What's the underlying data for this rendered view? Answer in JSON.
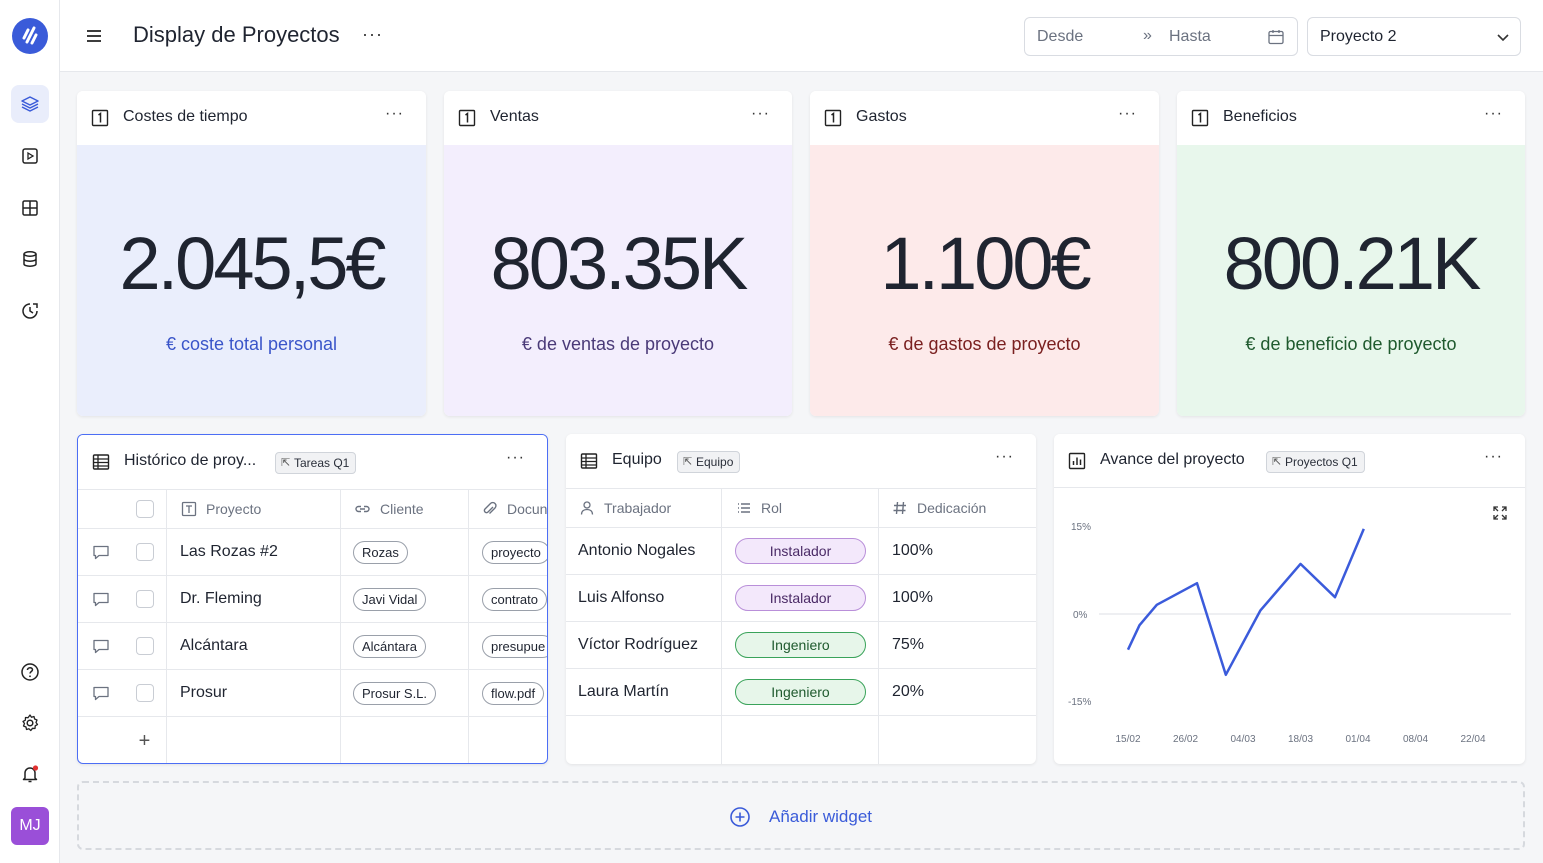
{
  "app": {
    "logo_icon": "app-logo-icon",
    "accent": "#3a5bd9"
  },
  "sidebar": {
    "items": [
      {
        "name": "layers-icon",
        "active": true
      },
      {
        "name": "play-square-icon",
        "active": false
      },
      {
        "name": "layout-grid-icon",
        "active": false
      },
      {
        "name": "database-icon",
        "active": false
      },
      {
        "name": "clock-history-icon",
        "active": false
      }
    ],
    "bottom": [
      {
        "name": "help-icon"
      },
      {
        "name": "settings-icon"
      },
      {
        "name": "notification-bell-icon"
      }
    ],
    "avatar_initials": "MJ"
  },
  "header": {
    "title": "Display de Proyectos",
    "more": "···",
    "date_from_placeholder": "Desde",
    "date_arrows": "»",
    "date_to_placeholder": "Hasta",
    "project_selected": "Proyecto 2"
  },
  "kpis": [
    {
      "badge": "1",
      "title": "Costes de tiempo",
      "value": "2.045,5€",
      "label": "€ coste total personal",
      "bg": "#eaeefc",
      "label_color": "#3a55c9"
    },
    {
      "badge": "1",
      "title": "Ventas",
      "value": "803.35K",
      "label": "€ de ventas de proyecto",
      "bg": "#f3eefd",
      "label_color": "#4a3a78"
    },
    {
      "badge": "1",
      "title": "Gastos",
      "value": "1.100€",
      "label": "€ de gastos de proyecto",
      "bg": "#fdeaea",
      "label_color": "#7a2020"
    },
    {
      "badge": "1",
      "title": "Beneficios",
      "value": "800.21K",
      "label": "€ de beneficio de proyecto",
      "bg": "#e8f7ec",
      "label_color": "#1f5a2e"
    }
  ],
  "more": "···",
  "historico": {
    "title": "Histórico de proy...",
    "tag": "Tareas Q1",
    "columns": [
      "Proyecto",
      "Cliente",
      "Docun"
    ],
    "rows": [
      {
        "proyecto": "Las Rozas #2",
        "cliente": "Rozas",
        "doc": "proyecto"
      },
      {
        "proyecto": "Dr. Fleming",
        "cliente": "Javi Vidal",
        "doc": "contrato"
      },
      {
        "proyecto": "Alcántara",
        "cliente": "Alcántara",
        "doc": "presupue"
      },
      {
        "proyecto": "Prosur",
        "cliente": "Prosur S.L.",
        "doc": "flow.pdf"
      }
    ],
    "add_row": "+"
  },
  "equipo": {
    "title": "Equipo",
    "tag": "Equipo",
    "columns": [
      "Trabajador",
      "Rol",
      "Dedicación"
    ],
    "rows": [
      {
        "trabajador": "Antonio Nogales",
        "rol": "Instalador",
        "dedicacion": "100%"
      },
      {
        "trabajador": "Luis Alfonso",
        "rol": "Instalador",
        "dedicacion": "100%"
      },
      {
        "trabajador": "Víctor Rodríguez",
        "rol": "Ingeniero",
        "dedicacion": "75%"
      },
      {
        "trabajador": "Laura Martín",
        "rol": "Ingeniero",
        "dedicacion": "20%"
      }
    ]
  },
  "avance": {
    "title": "Avance del proyecto",
    "tag": "Proyectos Q1"
  },
  "chart_data": {
    "type": "line",
    "x": [
      "15/02",
      "26/02",
      "04/03",
      "18/03",
      "01/04",
      "08/04",
      "22/04"
    ],
    "y_ticks": [
      "15%",
      "0%",
      "-15%"
    ],
    "ylim": [
      -15,
      15
    ],
    "grid": "zero-line",
    "series": [
      {
        "values_x": [
          0,
          0.2,
          0.5,
          1.2,
          1.7,
          2.3,
          3.0,
          3.6,
          4.1
        ]
      }
    ],
    "points": [
      {
        "x": 0.0,
        "y": -6.2
      },
      {
        "x": 0.2,
        "y": -2.0
      },
      {
        "x": 0.5,
        "y": 1.5
      },
      {
        "x": 1.2,
        "y": 5.2
      },
      {
        "x": 1.7,
        "y": -10.5
      },
      {
        "x": 2.3,
        "y": 0.5
      },
      {
        "x": 3.0,
        "y": 8.5
      },
      {
        "x": 3.6,
        "y": 2.8
      },
      {
        "x": 4.1,
        "y": 14.5
      }
    ],
    "line_color": "#3b5bdb"
  },
  "add_widget": {
    "label": "Añadir widget"
  }
}
